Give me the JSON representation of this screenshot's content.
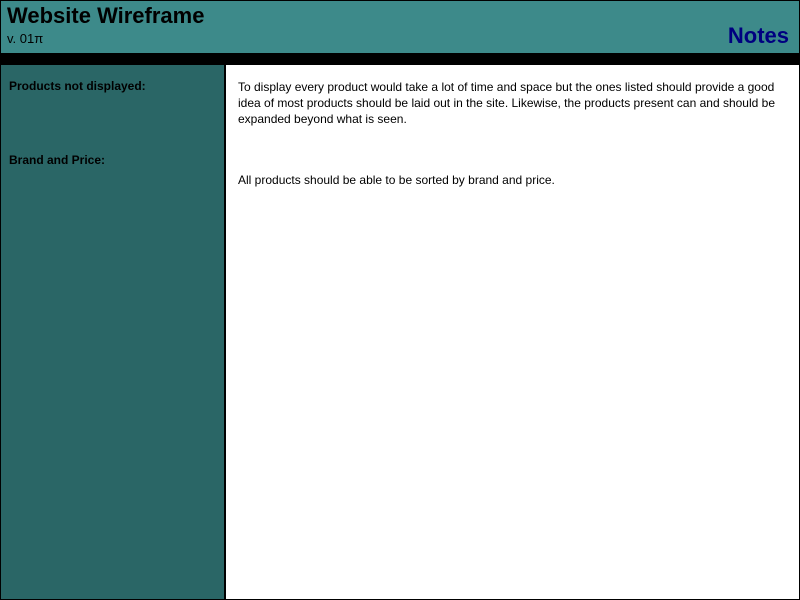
{
  "header": {
    "title": "Website Wireframe",
    "version": "v. 01π",
    "notes_label": "Notes"
  },
  "sections": [
    {
      "label": "Products not displayed:",
      "text": "To display every product would take a lot of time and space but the ones listed should provide a good idea of most products should be laid out in the site. Likewise, the products present can and should be expanded beyond what is seen."
    },
    {
      "label": "Brand and Price:",
      "text": "All products should be able to be sorted by brand and price."
    }
  ]
}
